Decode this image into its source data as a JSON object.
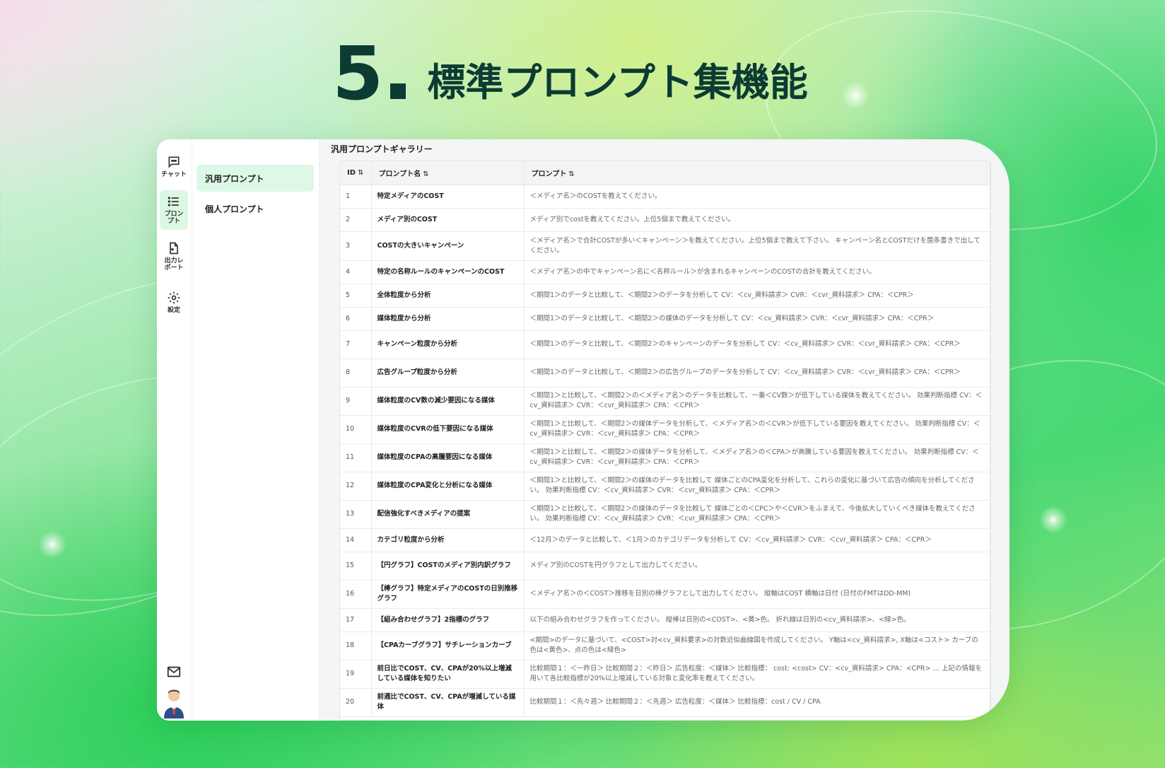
{
  "headline": {
    "number": "5",
    "title": "標準プロンプト集機能"
  },
  "rail": [
    {
      "label": "チャット",
      "icon": "chat-icon"
    },
    {
      "label": "プロンプト",
      "icon": "list-icon",
      "active": true
    },
    {
      "label": "出力レポート",
      "icon": "export-icon"
    },
    {
      "label": "設定",
      "icon": "gear-icon"
    }
  ],
  "subnav": [
    {
      "label": "汎用プロンプト",
      "active": true
    },
    {
      "label": "個人プロンプト"
    }
  ],
  "gallery_title": "汎用プロンプトギャラリー",
  "columns": {
    "id": "ID",
    "name": "プロンプト名",
    "prompt": "プロンプト",
    "sort_icon": "⇅"
  },
  "rows": [
    {
      "id": "1",
      "name": "特定メディアのCOST",
      "prompt": "＜メディア名＞のCOSTを教えてください。"
    },
    {
      "id": "2",
      "name": "メディア別のCOST",
      "prompt": "メディア別でcostを教えてください。上位5個まで教えてください。"
    },
    {
      "id": "3",
      "name": "COSTの大きいキャンペーン",
      "prompt": "＜メディア名＞で合計COSTが多い＜キャンペーン＞を教えてください。上位5個まで教えて下さい。 キャンペーン名とCOSTだけを箇条書きで出してください。"
    },
    {
      "id": "4",
      "name": "特定の名称ルールのキャンペーンのCOST",
      "prompt": "＜メディア名＞の中でキャンペーン名に＜名称ルール＞が含まれるキャンペーンのCOSTの合計を教えてください。"
    },
    {
      "id": "5",
      "name": "全体粒度から分析",
      "prompt": "＜期間1＞のデータと比較して、＜期間2＞のデータを分析して CV：＜cv_資料請求＞ CVR：＜cvr_資料請求＞ CPA：＜CPR＞"
    },
    {
      "id": "6",
      "name": "媒体粒度から分析",
      "prompt": "＜期間1＞のデータと比較して、＜期間2＞の媒体のデータを分析して CV：＜cv_資料請求＞ CVR：＜cvr_資料請求＞ CPA：＜CPR＞"
    },
    {
      "id": "7",
      "name": "キャンペーン粒度から分析",
      "prompt": "＜期間1＞のデータと比較して、＜期間2＞のキャンペーンのデータを分析して CV：＜cv_資料請求＞ CVR：＜cvr_資料請求＞ CPA：＜CPR＞"
    },
    {
      "id": "8",
      "name": "広告グループ粒度から分析",
      "prompt": "＜期間1＞のデータと比較して、＜期間2＞の広告グループのデータを分析して CV：＜cv_資料請求＞ CVR：＜cvr_資料請求＞ CPA：＜CPR＞"
    },
    {
      "id": "9",
      "name": "媒体粒度のCV数の減少要因になる媒体",
      "prompt": "＜期間1＞と比較して、＜期間2＞の＜メディア名＞のデータを比較して、一番＜CV数＞が低下している媒体を教えてください。 効果判断指標 CV：＜cv_資料請求＞ CVR：＜cvr_資料請求＞ CPA：＜CPR＞"
    },
    {
      "id": "10",
      "name": "媒体粒度のCVRの低下要因になる媒体",
      "prompt": "＜期間1＞と比較して、＜期間2＞の媒体データを分析して、＜メディア名＞の＜CVR＞が低下している要因を教えてください。 効果判断指標 CV：＜cv_資料請求＞ CVR：＜cvr_資料請求＞ CPA：＜CPR＞"
    },
    {
      "id": "11",
      "name": "媒体粒度のCPAの高騰要因になる媒体",
      "prompt": "＜期間1＞と比較して、＜期間2＞の媒体データを分析して、＜メディア名＞の＜CPA＞が高騰している要因を教えてください。 効果判断指標 CV：＜cv_資料請求＞ CVR：＜cvr_資料請求＞ CPA：＜CPR＞"
    },
    {
      "id": "12",
      "name": "媒体粒度のCPA変化と分析になる媒体",
      "prompt": "＜期間1＞と比較して、＜期間2＞の媒体のデータを比較して 媒体ごとのCPA変化を分析して、これらの変化に基づいて広告の傾向を分析してください。 効果判断指標 CV：＜cv_資料請求＞ CVR：＜cvr_資料請求＞ CPA：＜CPR＞"
    },
    {
      "id": "13",
      "name": "配信強化すべきメディアの提案",
      "prompt": "＜期間1＞と比較して、＜期間2＞の媒体のデータを比較して 媒体ごとの＜CPC＞や＜CVR＞をふまえて、今後拡大していくべき媒体を教えてください。 効果判断指標 CV：＜cv_資料請求＞ CVR：＜cvr_資料請求＞ CPA：＜CPR＞"
    },
    {
      "id": "14",
      "name": "カテゴリ粒度から分析",
      "prompt": "＜12月＞のデータと比較して、＜1月＞のカテゴリデータを分析して CV：＜cv_資料請求＞ CVR：＜cvr_資料請求＞ CPA：＜CPR＞"
    },
    {
      "id": "15",
      "name": "【円グラフ】COSTのメディア別内訳グラフ",
      "prompt": "メディア別のCOSTを円グラフとして出力してください。"
    },
    {
      "id": "16",
      "name": "【棒グラフ】特定メディアのCOSTの日別推移グラフ",
      "prompt": "＜メディア名＞の＜COST＞推移を日別の棒グラフとして出力してください。 縦軸はCOST 横軸は日付 (日付のFMTはDD-MM)"
    },
    {
      "id": "17",
      "name": "【組み合わせグラフ】2指標のグラフ",
      "prompt": "以下の組み合わせグラフを作ってください。 縦棒は日別の<COST>、<黄>色。 折れ線は日別の<cv_資料請求>、<緑>色。"
    },
    {
      "id": "18",
      "name": "【CPAカーブグラフ】サチレーションカーブ",
      "prompt": "<期間>のデータに基づいて、<COST>対<cv_資料要求>の対数近似曲線図を作成してください。 Y軸は<cv_資料請求>, X軸は<コスト> カーブの色は<黄色>、点の色は<緑色>"
    },
    {
      "id": "19",
      "name": "前日比でCOST、CV、CPAが20%以上増減している媒体を知りたい",
      "prompt": "比較期間１：＜一昨日＞ 比較期間２：＜昨日＞ 広告粒度：＜媒体＞ 比較指標： cost: <cost> CV：<cv_資料請求> CPA：<CPR> … 上記の情報を用いて各比較指標が20%以上増減している対象と変化率を教えてください。"
    },
    {
      "id": "20",
      "name": "前週比でCOST、CV、CPAが増減している媒体",
      "prompt": "比較期間１：＜先々週＞ 比較期間２：＜先週＞ 広告粒度：＜媒体＞ 比較指標：cost / CV / CPA"
    }
  ]
}
